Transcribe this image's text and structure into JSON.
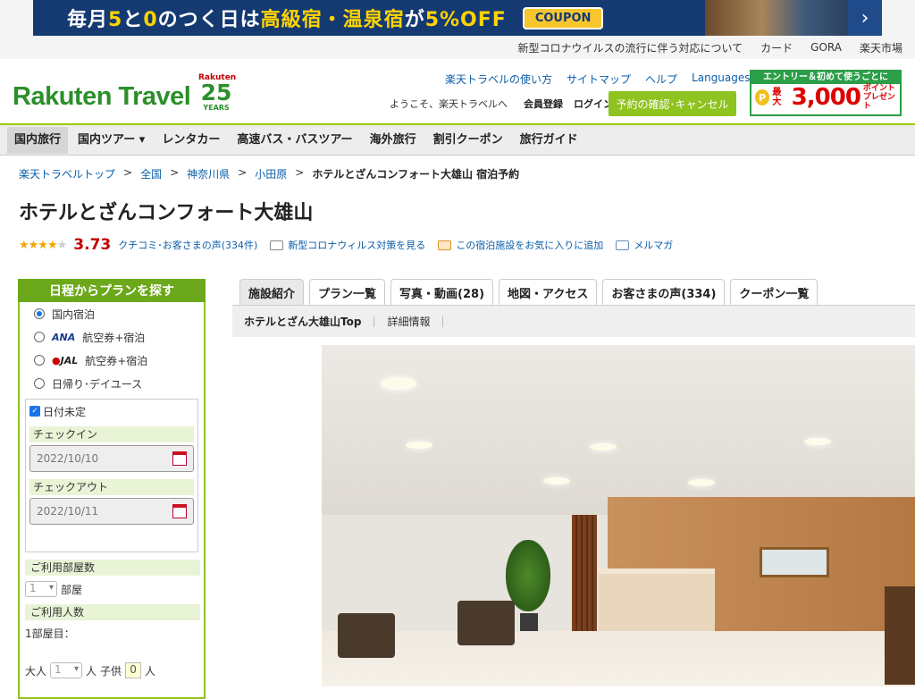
{
  "banner": {
    "text_a": "毎月",
    "num1": "5",
    "text_b": "と",
    "num2": "0",
    "text_c": "のつく日は",
    "hl": "高級宿・温泉宿",
    "text_d": "が",
    "off": "5%OFF",
    "coupon": "COUPON",
    "arrow": "›"
  },
  "util_links": [
    "新型コロナウイルスの流行に伴う対応について",
    "カード",
    "GORA",
    "楽天市場"
  ],
  "header": {
    "logo": "Rakuten Travel",
    "anniv_brand": "Rakuten",
    "anniv_num": "25",
    "anniv_years": "YEARS",
    "links": [
      "楽天トラベルの使い方",
      "サイトマップ",
      "ヘルプ"
    ],
    "languages": "Languages",
    "welcome": "ようこそ、楽天トラベルへ",
    "register": "会員登録",
    "login": "ログイン",
    "reserve_button": "予約の確認･キャンセル",
    "entry_top": "エントリー＆初めて使うごとに",
    "entry_coin": "P",
    "entry_max": "最大",
    "entry_amount": "3,000",
    "entry_pt1": "ポイント",
    "entry_pt2": "プレゼント"
  },
  "nav": [
    "国内旅行",
    "国内ツアー",
    "レンタカー",
    "高速バス・バスツアー",
    "海外旅行",
    "割引クーポン",
    "旅行ガイド"
  ],
  "breadcrumb": [
    "楽天トラベルトップ",
    "全国",
    "神奈川県",
    "小田原"
  ],
  "breadcrumb_current": "ホテルとざんコンフォート大雄山 宿泊予約",
  "sep": ">",
  "hotel_title": "ホテルとざんコンフォート大雄山",
  "rating": {
    "stars": 3.73,
    "score": "3.73",
    "reviews_link": "クチコミ･お客さまの声(334件)",
    "covid_link": "新型コロナウィルス対策を見る",
    "fav_link": "この宿泊施設をお気に入りに追加",
    "mail_link": "メルマガ"
  },
  "sidebar": {
    "heading": "日程からプランを探す",
    "options": [
      "国内宿泊",
      "航空券+宿泊",
      "航空券+宿泊",
      "日帰り･デイユース"
    ],
    "ana": "ANA",
    "jal": "JAL",
    "date_undecided": "日付未定",
    "checkin_label": "チェックイン",
    "checkin_value": "2022/10/10",
    "checkout_label": "チェックアウト",
    "checkout_value": "2022/10/11",
    "rooms_label": "ご利用部屋数",
    "rooms_value": "1",
    "rooms_unit": "部屋",
    "people_label": "ご利用人数",
    "room1": "1部屋目：",
    "adult": "大人",
    "adult_value": "1",
    "person": "人",
    "child": "子供",
    "child_value": "0",
    "person2": "人"
  },
  "tabs": [
    "施設紹介",
    "プラン一覧",
    "写真・動画(28)",
    "地図・アクセス",
    "お客さまの声(334)",
    "クーポン一覧"
  ],
  "subtabs": [
    "ホテルとざん大雄山Top",
    "詳細情報"
  ],
  "colors": {
    "brand_green": "#8fc31f",
    "rating_red": "#bf0000",
    "banner_navy": "#153a72"
  }
}
